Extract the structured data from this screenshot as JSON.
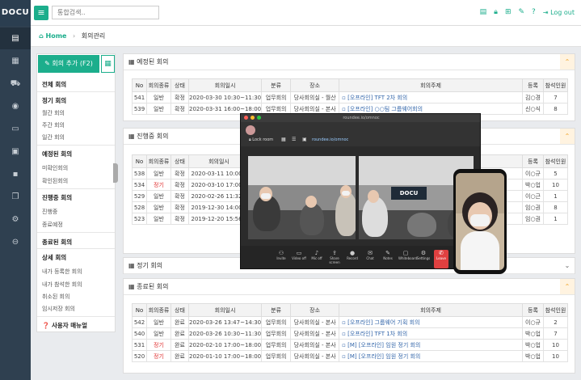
{
  "brand": {
    "logo": "DOCU",
    "accent": "#1cae8c"
  },
  "search": {
    "placeholder": "통합검색.."
  },
  "header": {
    "logout": "Log out"
  },
  "breadcrumb": {
    "home": "Home",
    "current": "회의관리"
  },
  "left": {
    "add_label": "회의 추가 (F2)",
    "all": "전체 회의",
    "regular": "정기 회의",
    "monthly": "월간 회의",
    "weekly": "주간 회의",
    "daily": "일간 회의",
    "scheduled": "예정된 회의",
    "unconfirmed": "미확인회의",
    "confirmed": "확인된회의",
    "ongoing": "진행중 회의",
    "in_progress": "진행중",
    "scheduled_end": "종료예정",
    "ended": "종료된 회의",
    "detail": "상세 회의",
    "my_meetings": "내가 등록한 회의",
    "joined": "내가 참석한 회의",
    "cancelled": "취소된 회의",
    "temp": "임시저장 회의",
    "manual": "사용자 매뉴얼"
  },
  "columns": [
    "No",
    "회의종류",
    "상태",
    "회의일시",
    "분류",
    "장소",
    "회의주제",
    "등록",
    "참석인원"
  ],
  "scheduled": {
    "title": "예정된 회의",
    "rows": [
      [
        "541",
        "일반",
        "확정",
        "2020-03-30 10:30~11:30",
        "업무회의",
        "당사회의실 - 월산",
        "[오프라인] TFT 2차 회의",
        "김○경",
        "7"
      ],
      [
        "539",
        "일반",
        "확정",
        "2020-03-31 16:00~18:00",
        "업무회의",
        "당사회의실 - 본사",
        "[오프라인] ○○팀 그룹웨어회의",
        "신○식",
        "8"
      ]
    ]
  },
  "ongoing": {
    "title": "진행중 회의",
    "rows": [
      [
        "538",
        "일반",
        "확정",
        "2020-03-11 10:00~",
        "업무회의",
        "당사회의실 - 본사",
        "",
        "이○규",
        "5"
      ],
      [
        "534",
        "정기",
        "확정",
        "2020-03-10 17:00~",
        "업무회의",
        "당사회의실 - 본사",
        "",
        "박○업",
        "10"
      ],
      [
        "529",
        "일반",
        "확정",
        "2020-02-26 11:32~",
        "업무회의",
        "당사회의실 - 본사",
        "",
        "이○근",
        "1"
      ],
      [
        "528",
        "일반",
        "확정",
        "2019-12-30 14:00~",
        "업무회의",
        "당사회의실 - 본사",
        "",
        "임○권",
        "8"
      ],
      [
        "523",
        "일반",
        "확정",
        "2019-12-20 15:56~",
        "업무회의",
        "당사회의실 - 본사",
        "",
        "임○권",
        "1"
      ]
    ]
  },
  "regular": {
    "title": "정기 회의"
  },
  "ended": {
    "title": "종료된 회의",
    "rows": [
      [
        "542",
        "일반",
        "완료",
        "2020-03-26 13:47~14:30",
        "업무회의",
        "당사회의실 - 본사",
        "[오프라인] 그룹웨어 기획 회의",
        "이○규",
        "2"
      ],
      [
        "540",
        "일반",
        "완료",
        "2020-03-26 10:30~11:30",
        "업무회의",
        "당사회의실 - 본사",
        "[오프라인] TFT 1차 회의",
        "박○업",
        "7"
      ],
      [
        "531",
        "정기",
        "완료",
        "2020-02-10 17:00~18:00",
        "업무회의",
        "당사회의실 - 본사",
        "[M] [오프라인] 임원 정기 회의",
        "박○업",
        "10"
      ],
      [
        "520",
        "정기",
        "완료",
        "2020-01-10 17:00~18:00",
        "업무회의",
        "당사회의실 - 본사",
        "[M] [오프라인] 임원 정기 회의",
        "박○업",
        "10"
      ]
    ]
  },
  "video": {
    "title": "roundee.io/omnoc",
    "lock": "Lock room",
    "url": "roundee.io/omnoc",
    "buttons": [
      "Invite",
      "Video off",
      "Mic off",
      "Share screen",
      "Record",
      "Chat",
      "Notes",
      "Whiteboard",
      "Settings",
      "Leave"
    ],
    "wall_logo": "DOCU"
  }
}
